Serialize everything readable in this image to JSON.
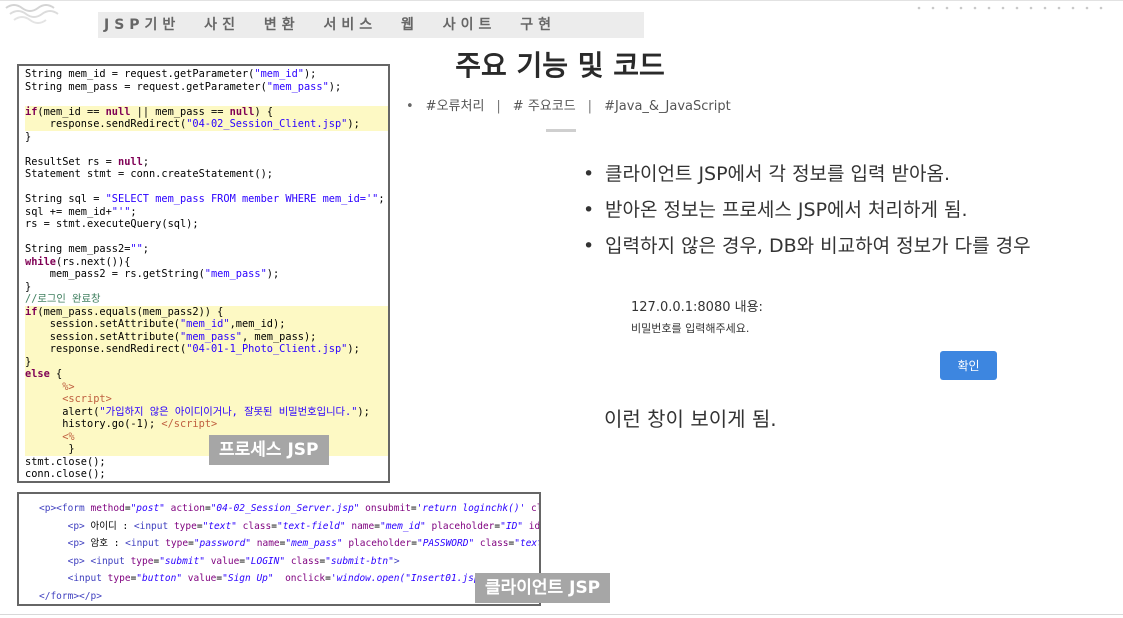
{
  "slide": {
    "header": "JSP기반 사진 변환 서비스 웹 사이트 구현",
    "title": "주요 기능 및 코드",
    "tags": [
      "#오류처리",
      "# 주요코드",
      "#Java_&_JavaScript"
    ],
    "tag_bullet": "•",
    "tag_separator": "|"
  },
  "server_code": {
    "label": "프로세스 JSP"
  },
  "client_code": {
    "label": "클라이언트 JSP"
  },
  "bullets": [
    "클라이언트 JSP에서 각 정보를 입력 받아옴.",
    "받아온 정보는 프로세스 JSP에서 처리하게 됨.",
    "입력하지 않은 경우, DB와 비교하여 정보가 다를 경우"
  ],
  "bullet_glyph": "•",
  "dialog": {
    "origin": "127.0.0.1:8080 내용:",
    "message": "비밀번호를 입력해주세요.",
    "ok_label": "확인"
  },
  "caption": "이런 창이 보이게 됨.",
  "colors": {
    "accent_button": "#3d86e0",
    "highlight": "#fdf9c4",
    "label_bg": "#a6a6a6"
  }
}
